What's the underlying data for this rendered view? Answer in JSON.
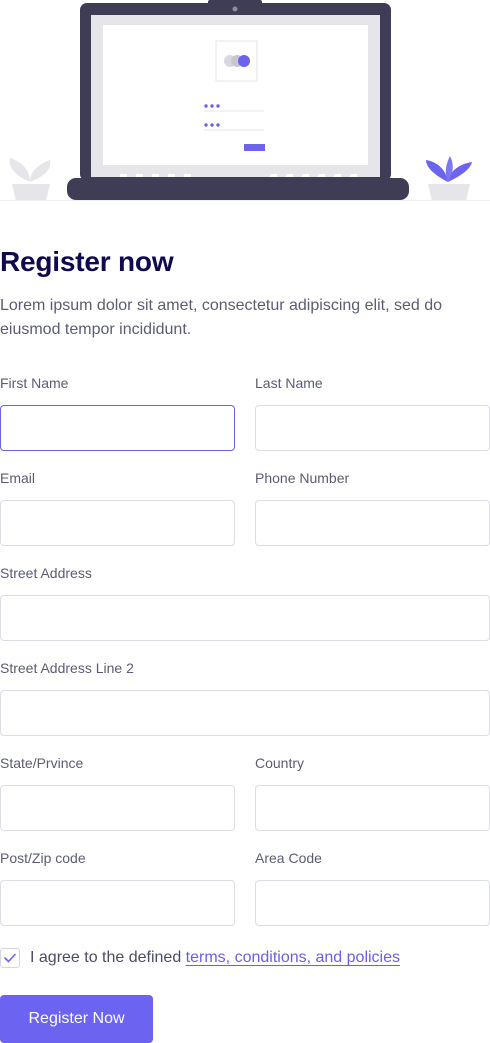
{
  "header": {
    "title": "Register now",
    "description": "Lorem ipsum dolor sit amet, consectetur adipiscing elit, sed do eiusmod tempor incididunt."
  },
  "form": {
    "first_name": {
      "label": "First Name",
      "value": "",
      "focused": true
    },
    "last_name": {
      "label": "Last Name",
      "value": ""
    },
    "email": {
      "label": "Email",
      "value": ""
    },
    "phone": {
      "label": "Phone Number",
      "value": ""
    },
    "street": {
      "label": "Street Address",
      "value": ""
    },
    "street2": {
      "label": "Street Address Line 2",
      "value": ""
    },
    "state": {
      "label": "State/Prvince",
      "value": ""
    },
    "country": {
      "label": "Country",
      "value": ""
    },
    "zip": {
      "label": "Post/Zip code",
      "value": ""
    },
    "area_code": {
      "label": "Area Code",
      "value": ""
    }
  },
  "agreement": {
    "checked": true,
    "text": "I agree to the defined ",
    "link_text": "terms, conditions, and policies"
  },
  "submit": {
    "label": "Register Now"
  },
  "colors": {
    "accent": "#6c63f0",
    "heading": "#0f0a4e",
    "body_text": "#5a5d75",
    "border": "#dcdde6",
    "laptop": "#3f3d56"
  }
}
